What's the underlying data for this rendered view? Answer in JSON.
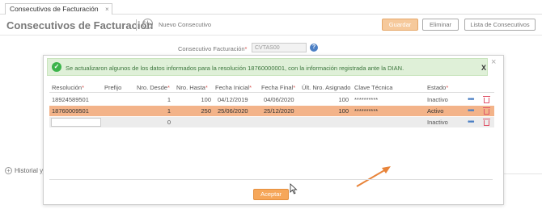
{
  "tab": {
    "label": "Consecutivos de Facturación",
    "close": "×"
  },
  "header": {
    "title": "Consecutivos de Facturación",
    "add_label": "Nuevo Consecutivo",
    "add_icon": "plus-circle-icon",
    "buttons": {
      "guardar": "Guardar",
      "eliminar": "Eliminar",
      "lista": "Lista de Consecutivos"
    },
    "colors": {
      "primary_button": "#f6c99b"
    }
  },
  "background_form": {
    "consecutivo_label": "Consecutivo Facturación",
    "required_mark": "*",
    "consecutivo_value": "CVTAS00",
    "help_icon": "question-circle-icon",
    "help_glyph": "?",
    "historial_label": "Historial y"
  },
  "modal": {
    "close": "×",
    "alert": {
      "icon": "check-circle-icon",
      "icon_glyph": "✓",
      "message": "Se actualizaron algunos de los datos informados para la resolución 18760000001, con la información registrada ante la DIAN.",
      "close": "X",
      "color": "#dff0d8"
    },
    "table": {
      "headers": {
        "resolucion": "Resolución",
        "prefijo": "Prefijo",
        "nro_desde": "Nro. Desde",
        "nro_hasta": "Nro. Hasta",
        "fecha_inicial": "Fecha Inicial",
        "fecha_final": "Fecha Final",
        "ult_nro": "Últ. Nro. Asignado",
        "clave": "Clave Técnica",
        "estado": "Estado"
      },
      "rows": [
        {
          "resolucion": "18924589501",
          "prefijo": "",
          "nro_desde": "1",
          "nro_hasta": "100",
          "fecha_inicial": "04/12/2019",
          "fecha_final": "04/06/2020",
          "ult_nro": "100",
          "clave": "**********",
          "estado": "Inactivo",
          "menu": "•••"
        },
        {
          "resolucion": "18760009501",
          "prefijo": "",
          "nro_desde": "1",
          "nro_hasta": "250",
          "fecha_inicial": "25/06/2020",
          "fecha_final": "25/12/2020",
          "ult_nro": "100",
          "clave": "**********",
          "estado": "Activo",
          "menu": "•••"
        },
        {
          "resolucion": "",
          "prefijo": "",
          "nro_desde": "0",
          "nro_hasta": "",
          "fecha_inicial": "",
          "fecha_final": "",
          "ult_nro": "",
          "clave": "",
          "estado": "Inactivo",
          "menu": "•••"
        }
      ],
      "highlight_color": "#f3b389"
    },
    "aceptar": "Aceptar"
  }
}
